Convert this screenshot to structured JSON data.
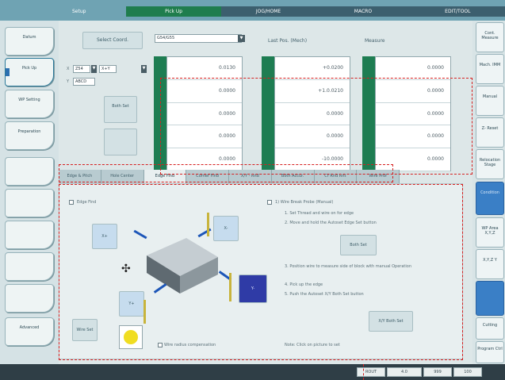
{
  "top_tabs": [
    {
      "label": "Setup",
      "state": "normal"
    },
    {
      "label": "Pick Up",
      "state": "active"
    },
    {
      "label": "JOG/HOME",
      "state": "dark"
    },
    {
      "label": "MACRO",
      "state": "dark"
    },
    {
      "label": "EDIT/TOOL",
      "state": "dark"
    }
  ],
  "left_menu": [
    {
      "label": "Datum"
    },
    {
      "label": "Pick Up"
    },
    {
      "label": "WP Setting"
    },
    {
      "label": "Preparation"
    },
    {
      "label": ""
    },
    {
      "label": ""
    },
    {
      "label": ""
    },
    {
      "label": ""
    },
    {
      "label": ""
    },
    {
      "label": "Advanced"
    }
  ],
  "right_menu": [
    {
      "label": "Cont. Measure"
    },
    {
      "label": "Mach. IMM"
    },
    {
      "label": "Manual"
    },
    {
      "label": "Z- Reset"
    },
    {
      "label": "Relocation Stage"
    },
    {
      "label": "Condition",
      "blue": true
    },
    {
      "label": "WP Area X,Y,Z"
    },
    {
      "label": "X,Y,Z Y"
    },
    {
      "label": "",
      "blue": true
    },
    {
      "label": "Cutting"
    },
    {
      "label": "Program Ctrl"
    }
  ],
  "select_coord_label": "Select Coord.",
  "coord_dropdown_value": "G54/G55",
  "small_field_1": "Z54",
  "small_field_2": "X+Y",
  "small_field_3": "ABCD",
  "side_button_1": "Both Set",
  "side_button_2": "",
  "last_pos_header": "Last Pos. (Mech)",
  "measure_header": "Measure",
  "columns": {
    "coord": [
      "0.0130",
      "0.0000",
      "0.0000",
      "0.0000",
      "0.0000"
    ],
    "last_pos": [
      "+0.0200",
      "+1.0.0210",
      "0.0000",
      "0.0000",
      "-10.0000"
    ],
    "measure": [
      "0.0000",
      "0.0000",
      "0.0000",
      "0.0000",
      "0.0000"
    ]
  },
  "sub_tabs": [
    "Edge & Pitch",
    "Hole Center",
    "Edge Find",
    "Corner Find",
    "X/Y - Rnd",
    "Both Accur.",
    "Cr Rnd Rnt",
    "Wire Prof"
  ],
  "active_sub_tab_index": 2,
  "panel": {
    "edge_find_label": "Edge Find",
    "direction_buttons": [
      "X+",
      "X-",
      "Y+",
      "Y-"
    ],
    "bottom_button": "Wire Set",
    "compensation_label": "Wire radius compensation",
    "procedure_title": "1) Wire Break Probe (Manual)",
    "steps": [
      "1. Set Thread and wire on for edge",
      "2. Move and hold the Autoset Edge Set button",
      "3. Position wire to measure side of block with manual Operation",
      "4. Pick up the edge",
      "5. Push the Autoset X/Y Both Set button"
    ],
    "edge_set_button": "Both Set",
    "xy_set_button": "X/Y Both Set",
    "note": "Note: Click on picture to set"
  },
  "status_boxes": [
    "ROUT",
    "4.0",
    "999",
    "100"
  ],
  "colors": {
    "accent_green": "#1e7d52",
    "highlight_red": "#d62020",
    "blue_button": "#3a7fc6"
  }
}
